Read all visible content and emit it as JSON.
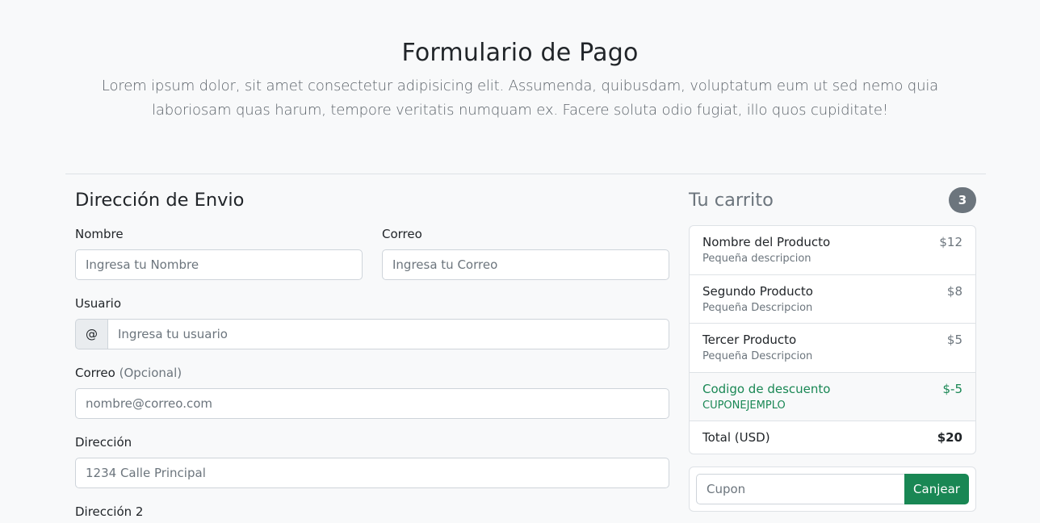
{
  "header": {
    "title": "Formulario de Pago",
    "lead": "Lorem ipsum dolor, sit amet consectetur adipisicing elit. Assumenda, quibusdam, voluptatum eum ut sed nemo quia laboriosam quas harum, tempore veritatis numquam ex. Facere soluta odio fugiat, illo quos cupiditate!"
  },
  "form": {
    "heading": "Dirección de Envio",
    "nombre": {
      "label": "Nombre",
      "placeholder": "Ingresa tu Nombre"
    },
    "correo": {
      "label": "Correo",
      "placeholder": "Ingresa tu Correo"
    },
    "usuario": {
      "label": "Usuario",
      "addon": "@",
      "placeholder": "Ingresa tu usuario"
    },
    "correo_opcional": {
      "label": "Correo",
      "label_note": "(Opcional)",
      "placeholder": "nombre@correo.com"
    },
    "direccion": {
      "label": "Dirección",
      "placeholder": "1234 Calle Principal"
    },
    "direccion2": {
      "label": "Dirección 2"
    }
  },
  "cart": {
    "heading": "Tu carrito",
    "count": "3",
    "items": [
      {
        "name": "Nombre del Producto",
        "desc": "Pequeña descripcion",
        "price": "$12"
      },
      {
        "name": "Segundo Producto",
        "desc": "Pequeña Descripcion",
        "price": "$8"
      },
      {
        "name": "Tercer Producto",
        "desc": "Pequeña Descripcion",
        "price": "$5"
      }
    ],
    "discount": {
      "name": "Codigo de descuento",
      "code": "CUPONEJEMPLO",
      "amount": "$-5"
    },
    "total": {
      "label": "Total (USD)",
      "value": "$20"
    },
    "coupon": {
      "placeholder": "Cupon",
      "button": "Canjear"
    }
  },
  "colors": {
    "accent": "#198754",
    "muted": "#6c757d",
    "background": "#f8f9fa"
  }
}
